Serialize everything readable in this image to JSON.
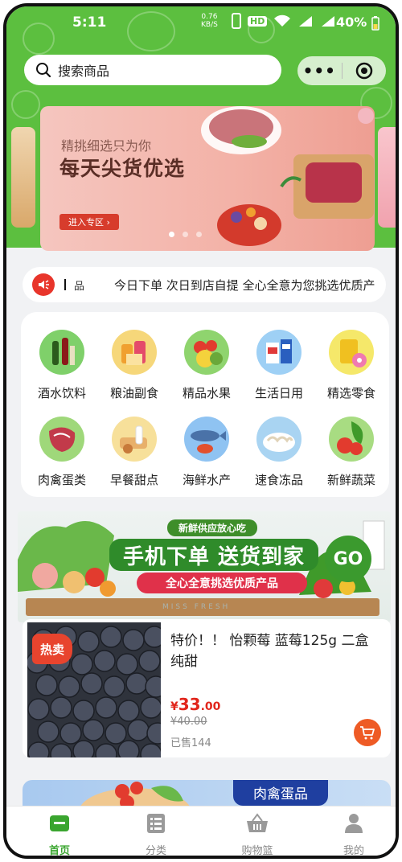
{
  "status_bar": {
    "time": "5:11",
    "speed_value": "0.76",
    "speed_unit": "KB/S",
    "hd": "HD",
    "battery": "40%"
  },
  "search": {
    "placeholder": "搜索商品"
  },
  "capsule": {
    "more": "•••"
  },
  "banner": {
    "subtitle": "精挑细选只为你",
    "title": "每天尖货优选",
    "button": "进入专区 ›"
  },
  "notice": {
    "fragment": "品",
    "message": "今日下单 次日到店自提 全心全意为您挑选优质产"
  },
  "categories": [
    {
      "label": "酒水饮料"
    },
    {
      "label": "粮油副食"
    },
    {
      "label": "精品水果"
    },
    {
      "label": "生活日用"
    },
    {
      "label": "精选零食"
    },
    {
      "label": "肉禽蛋类"
    },
    {
      "label": "早餐甜点"
    },
    {
      "label": "海鲜水产"
    },
    {
      "label": "速食冻品"
    },
    {
      "label": "新鲜蔬菜"
    }
  ],
  "promo": {
    "top": "新鲜供应放心吃",
    "main": "手机下单 送货到家",
    "go": "GO",
    "slogan": "全心全意挑选优质产品",
    "brand": "MISS FRESH"
  },
  "product": {
    "badge": "热卖",
    "name": "特价！！ 怡颗莓 蓝莓125g 二盒纯甜",
    "price_symbol": "¥",
    "price_int": "33",
    "price_dec": ".00",
    "original_price": "¥40.00",
    "sold": "已售144"
  },
  "section": {
    "tag": "肉禽蛋品"
  },
  "tabbar": [
    {
      "label": "首页",
      "active": true
    },
    {
      "label": "分类",
      "active": false
    },
    {
      "label": "购物篮",
      "active": false
    },
    {
      "label": "我的",
      "active": false
    }
  ],
  "colors": {
    "brand_green": "#5cbf3f",
    "price_red": "#e1251b",
    "tab_active": "#3aa52f",
    "cart_orange": "#ee5b25"
  }
}
